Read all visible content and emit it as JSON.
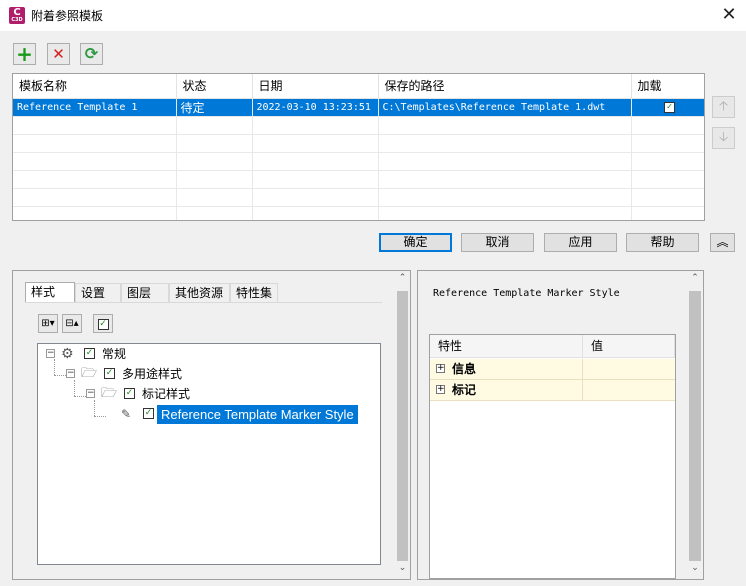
{
  "window": {
    "title": "附着参照模板",
    "app_icon_text": "C",
    "app_icon_sub": "C3D",
    "close_glyph": "✕"
  },
  "toolbar": {
    "add_glyph": "+",
    "remove_glyph": "✕",
    "refresh_glyph": "⟳"
  },
  "template_table": {
    "columns": [
      "模板名称",
      "状态",
      "日期",
      "保存的路径",
      "加载"
    ],
    "rows": [
      {
        "name": "Reference Template 1",
        "status": "待定",
        "date": "2022-03-10 13:23:51",
        "path": "C:\\Templates\\Reference Template 1.dwt",
        "load": "✓"
      }
    ]
  },
  "side_buttons": {
    "up": "🡡",
    "down": "🡣"
  },
  "buttons": {
    "ok": "确定",
    "cancel": "取消",
    "apply": "应用",
    "help": "帮助",
    "collapse": "︽"
  },
  "tabs": [
    "样式",
    "设置",
    "图层",
    "其他资源",
    "特性集"
  ],
  "tree": {
    "nodes": [
      {
        "label": "常规",
        "check": "✓"
      },
      {
        "label": "多用途样式",
        "check": "✓"
      },
      {
        "label": "标记样式",
        "check": "✓"
      },
      {
        "label": "Reference Template Marker Style",
        "check": "✓"
      }
    ]
  },
  "details": {
    "title": "Reference Template Marker Style",
    "prop_headers": [
      "特性",
      "值"
    ],
    "prop_rows": [
      "信息",
      "标记"
    ]
  },
  "colors": {
    "selection": "#0078d7",
    "add_green": "#1a9a1a",
    "remove_red": "#d42020",
    "refresh_green": "#2c9a40",
    "prop_row_bg": "#fffbe3"
  }
}
